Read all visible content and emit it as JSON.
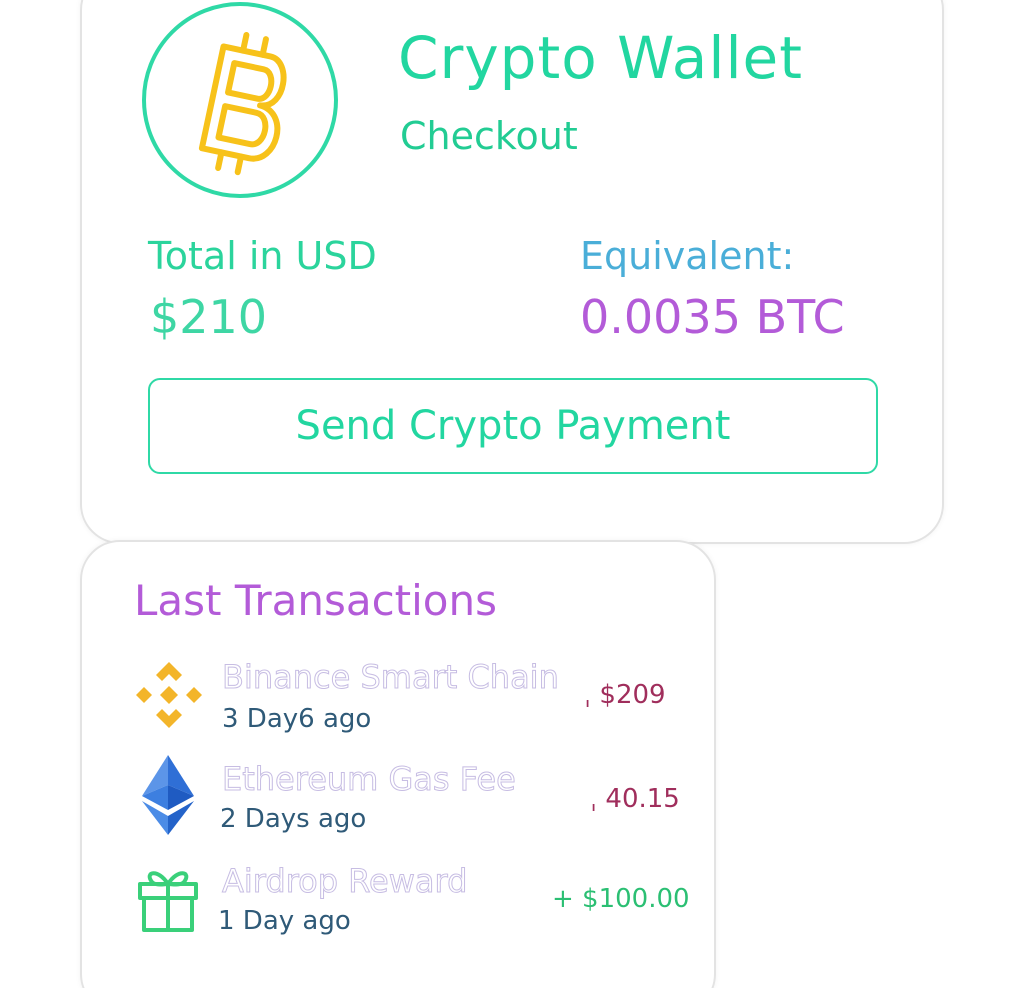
{
  "header": {
    "title": "Crypto Wallet",
    "subtitle": "Checkout",
    "logo_icon": "bitcoin-icon"
  },
  "summary": {
    "total_label": "Total in USD",
    "total_value": "$210",
    "equivalent_label": "Equivalent:",
    "equivalent_value": "0.0035 BTC"
  },
  "actions": {
    "send_label": "Send Crypto Payment"
  },
  "transactions": {
    "heading": "Last Transactions",
    "items": [
      {
        "icon": "binance-icon",
        "name": "Binance Smart Chain",
        "time": "3 Day6 ago",
        "amount": "ˌ $209",
        "direction": "out"
      },
      {
        "icon": "ethereum-icon",
        "name": "Ethereum Gas Fee",
        "time": "2 Days ago",
        "amount": "ˌ 40.15",
        "direction": "out"
      },
      {
        "icon": "gift-icon",
        "name": "Airdrop Reward",
        "time": "1 Day ago",
        "amount": "+ $100.00",
        "direction": "in"
      }
    ]
  },
  "colors": {
    "accent": "#22d6a0",
    "purple": "#b35bd8",
    "blue": "#4aaed8",
    "negative": "#a02e5c",
    "positive": "#2bbf73",
    "bitcoin": "#f7c21a"
  }
}
